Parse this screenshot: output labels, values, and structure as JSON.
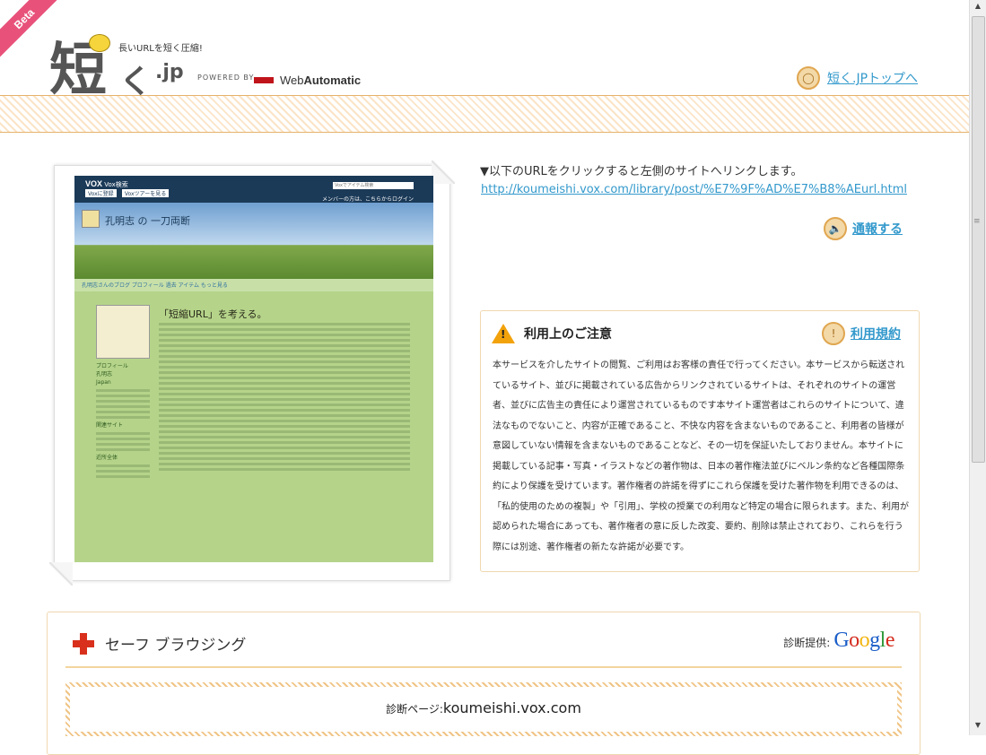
{
  "header": {
    "beta": "Beta",
    "logo_kanji": "短",
    "logo_ku": "く",
    "logo_jp": ".jp",
    "tagline": "長いURLを短く圧縮!",
    "powered_by": "POWERED BY",
    "webautomatic_prefix": "Web",
    "webautomatic_bold": "Automatic",
    "top_link": "短く.JPトップへ"
  },
  "preview": {
    "vox": "VOX",
    "vox_sub": "Vox検索",
    "search_placeholder": "Voxでアイテム検索",
    "btn_register": "Voxに登録",
    "btn_tour": "Voxツアーを見る",
    "login": "メンバーの方は、こちらからログイン",
    "blog_title": "孔明志 の 一刀両断",
    "nav": "孔明志さんのブログ  プロフィール  過去  アイテム  もっと見る",
    "post_title": "「短縮URL」を考える。",
    "profile_heading": "プロフィール",
    "profile_name": "孔明志",
    "profile_loc": "Japan",
    "links_heading": "関連サイト",
    "recent_heading": "近所全体"
  },
  "main": {
    "notice": "▼以下のURLをクリックすると左側のサイトへリンクします。",
    "url": "http://koumeishi.vox.com/library/post/%E7%9F%AD%E7%B8%AEurl.html",
    "report": "通報する"
  },
  "caution": {
    "title": "利用上のご注意",
    "terms_link": "利用規約",
    "body": "本サービスを介したサイトの閲覧、ご利用はお客様の責任で行ってください。本サービスから転送されているサイト、並びに掲載されている広告からリンクされているサイトは、それぞれのサイトの運営者、並びに広告主の責任により運営されているものです本サイト運営者はこれらのサイトについて、違法なものでないこと、内容が正確であること、不快な内容を含まないものであること、利用者の皆様が意図していない情報を含まないものであることなど、その一切を保証いたしておりません。本サイトに掲載している記事・写真・イラストなどの著作物は、日本の著作権法並びにベルン条約など各種国際条約により保護を受けています。著作権者の許諾を得ずにこれら保護を受けた著作物を利用できるのは、「私的使用のための複製」や「引用」、学校の授業での利用など特定の場合に限られます。また、利用が認められた場合にあっても、著作権者の意に反した改変、要約、削除は禁止されており、これらを行う際には別途、著作権者の新たな許諾が必要です。"
  },
  "safe_browsing": {
    "title": "セーフ ブラウジング",
    "diag_label": "診断提供:",
    "google": "Google",
    "diag_page_label": "診断ページ:",
    "diag_page_value": "koumeishi.vox.com"
  },
  "colors": {
    "link": "#3399cc",
    "accent_orange": "#e6b36a",
    "beta_pink": "#e8527a",
    "cross_red": "#d8301c"
  }
}
